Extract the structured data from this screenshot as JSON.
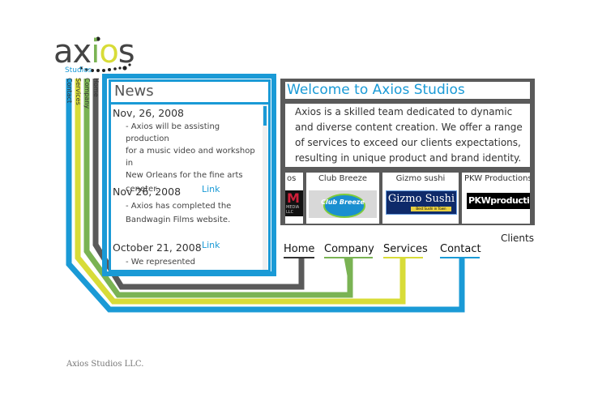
{
  "colors": {
    "blue": "#1a9ad6",
    "yellow": "#d8dc38",
    "green": "#7ab353",
    "gray": "#5a5a5a",
    "dark": "#333333"
  },
  "logo": {
    "text": "axios",
    "subtitle": "Studios"
  },
  "vertical_nav": [
    "Contact",
    "Services",
    "Company",
    "Home"
  ],
  "news": {
    "title": "News",
    "items": [
      {
        "date": "Nov, 26, 2008",
        "lines": [
          "- Axios will be assisting production",
          "for a music video and workshop in",
          "New Orleans for the fine arts",
          "ceneter."
        ],
        "link": ""
      },
      {
        "date": "Nov 26, 2008",
        "lines": [
          "- Axios has completed the",
          "Bandwagin Films website."
        ],
        "link": "Link"
      },
      {
        "date": "October 21, 2008",
        "lines": [
          "- We represented"
        ],
        "link": "Link"
      }
    ]
  },
  "welcome": {
    "title": "Welcome to Axios Studios",
    "body": "Axios is a skilled team dedicated to dynamic and diverse content creation. We offer a range of services to exceed our clients expectations, resulting in unique product and brand identity."
  },
  "clients": {
    "label": "Clients",
    "items": [
      {
        "name": "os",
        "logo": "M",
        "logo_sub": "MEDIA LLC"
      },
      {
        "name": "Club Breeze",
        "logo": "Club Breeze"
      },
      {
        "name": "Gizmo sushi",
        "logo": "Gizmo Sushi",
        "logo_sub": "Best Sushi in Town"
      },
      {
        "name": "PKW Productions",
        "logo": "PKWproductions"
      }
    ]
  },
  "nav": {
    "home": "Home",
    "company": "Company",
    "services": "Services",
    "contact": "Contact"
  },
  "footer": "Axios Studios LLC."
}
